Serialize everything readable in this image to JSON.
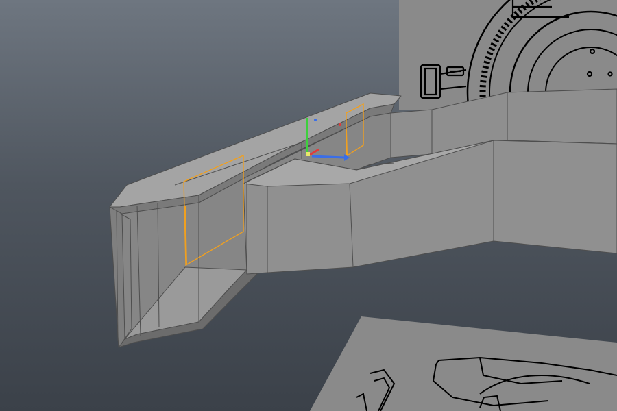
{
  "viewport": {
    "background_top": "#6e7680",
    "background_bottom": "#3b4149"
  },
  "colors": {
    "model_face_light": "#a3a3a3",
    "model_face_mid": "#8c8c8c",
    "model_face_dark": "#6f6f6f",
    "model_edge": "#4e4e4e",
    "selection_edge": "#f0a020",
    "reference_plane": "#8a8a8a",
    "reference_line": "#000000",
    "gizmo_x": "#e23a3a",
    "gizmo_y": "#3ecf3e",
    "gizmo_z": "#3a6ee8"
  },
  "objects": {
    "model": "arm-bracket-mesh",
    "selected": "edge-loop-selection",
    "manipulator": "move-gizmo",
    "references": [
      "reference-image-gear",
      "reference-image-bottom"
    ]
  }
}
